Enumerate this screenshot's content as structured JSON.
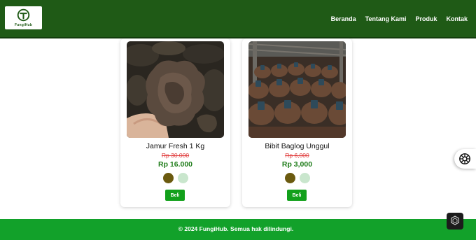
{
  "brand": {
    "logo_text": "FungiHub"
  },
  "nav": {
    "items": [
      {
        "label": "Beranda"
      },
      {
        "label": "Tentang Kami"
      },
      {
        "label": "Produk"
      },
      {
        "label": "Kontak"
      }
    ]
  },
  "products": [
    {
      "title": "Jamur Fresh 1 Kg",
      "old_price": "Rp 30.000",
      "price": "Rp 16.000",
      "swatches": [
        "#6b5a0f",
        "#c9e6cd"
      ],
      "buy_label": "Beli"
    },
    {
      "title": "Bibit Baglog Unggul",
      "old_price": "Rp 6,000",
      "price": "Rp 3,000",
      "swatches": [
        "#6b5a0f",
        "#c9e6cd"
      ],
      "buy_label": "Beli"
    }
  ],
  "footer": {
    "text": "© 2024 FungiHub. Semua hak dilindungi."
  },
  "colors": {
    "navbar": "#1f5a16",
    "footer": "#12a12a",
    "price_green": "#1e7c19",
    "old_price_red": "#e03b3b",
    "button_green": "#12a01b"
  },
  "icons": {
    "logo": "fungihub-logo-icon",
    "side_widget": "settings-flower-icon",
    "dark_widget": "hexagon-emblem-icon"
  }
}
